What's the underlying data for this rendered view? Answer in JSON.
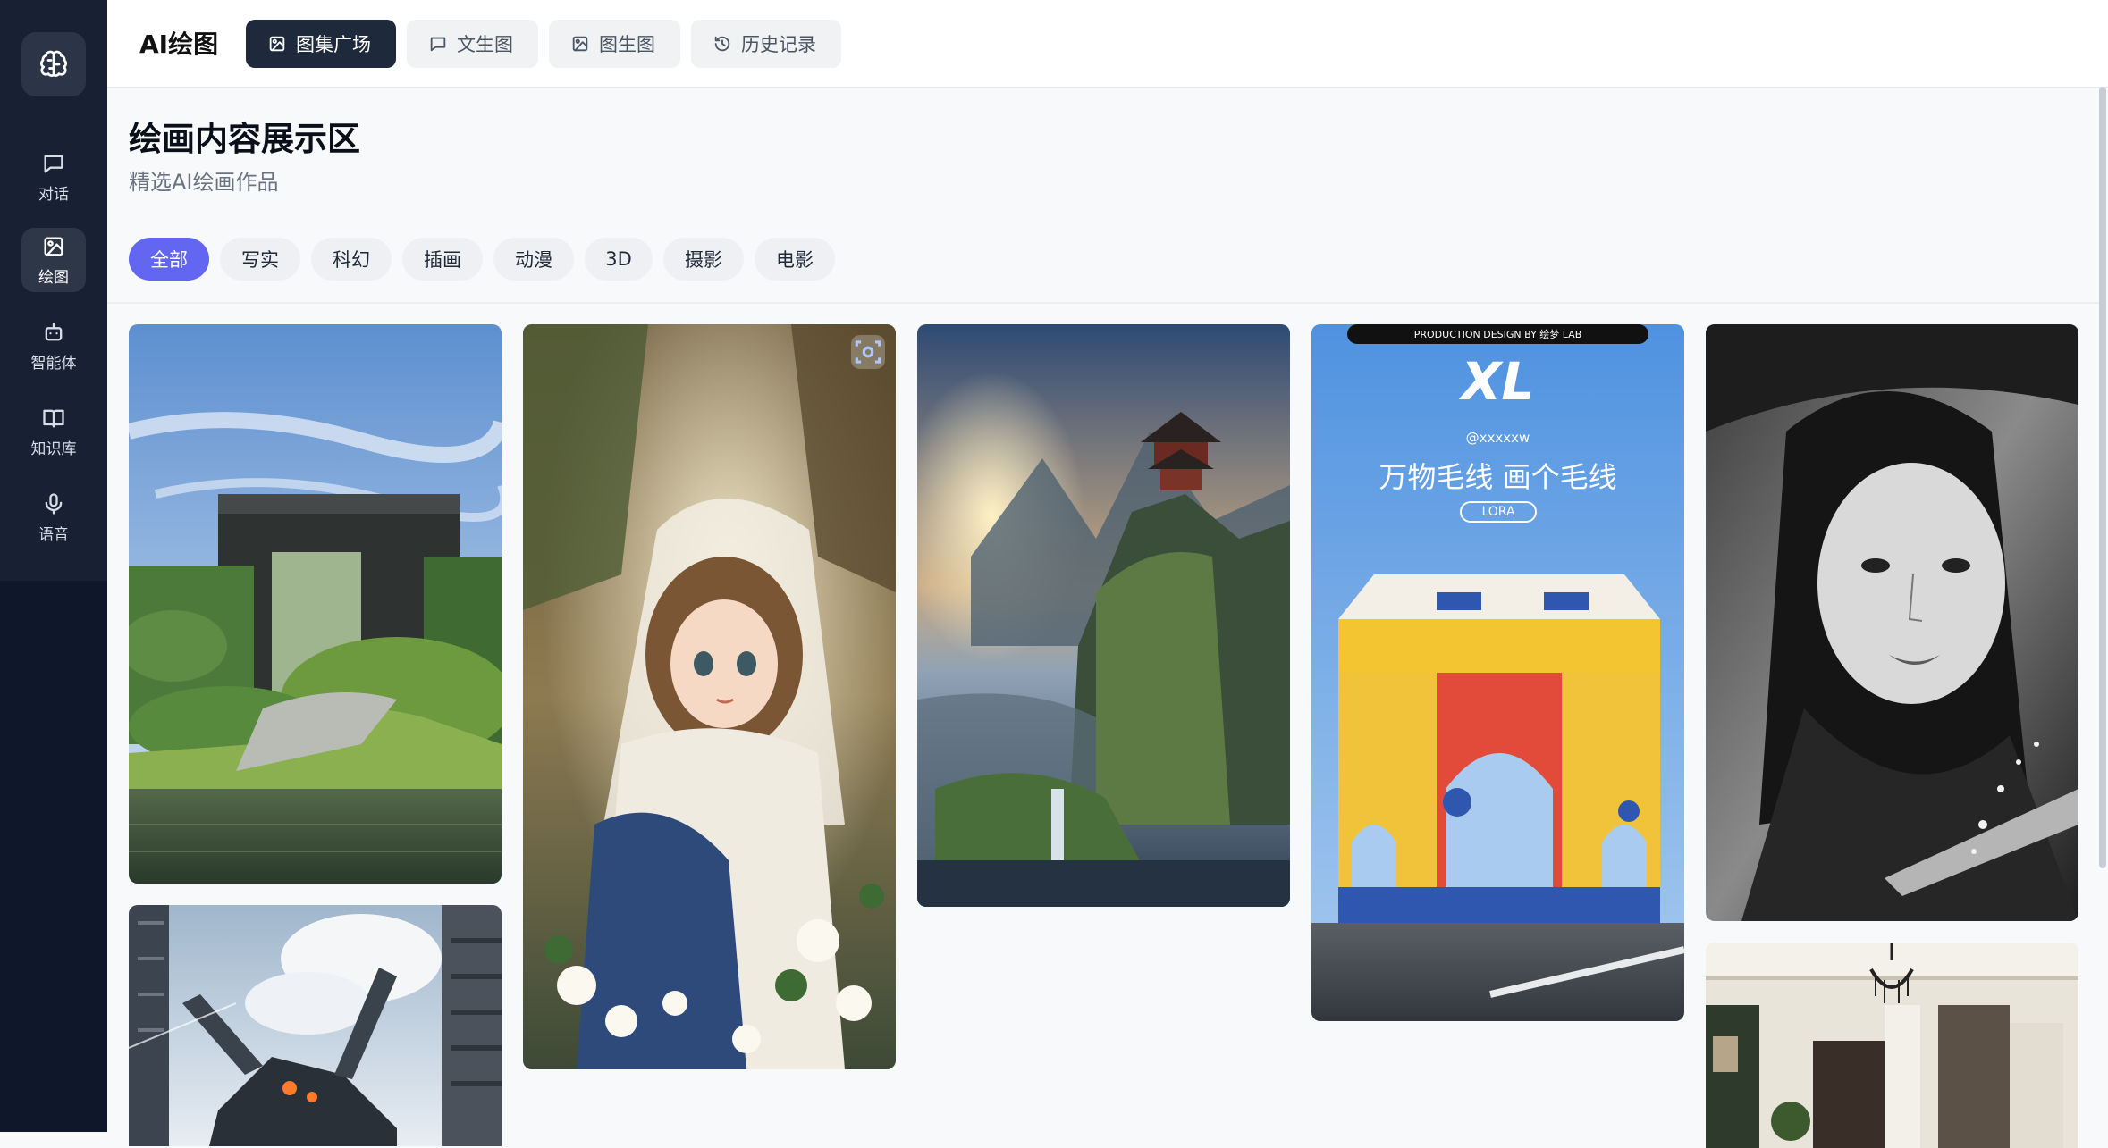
{
  "app": {
    "title": "AI绘图"
  },
  "header": {
    "tabs": [
      {
        "label": "图集广场",
        "icon": "image-icon",
        "active": true
      },
      {
        "label": "文生图",
        "icon": "chat-bubble-icon",
        "active": false
      },
      {
        "label": "图生图",
        "icon": "image-icon",
        "active": false
      },
      {
        "label": "历史记录",
        "icon": "history-icon",
        "active": false
      }
    ]
  },
  "sidebar": {
    "logo_icon": "brain-icon",
    "items": [
      {
        "label": "对话",
        "icon": "chat-bubble-icon",
        "active": false
      },
      {
        "label": "绘图",
        "icon": "image-icon",
        "active": true
      },
      {
        "label": "智能体",
        "icon": "bot-icon",
        "active": false
      },
      {
        "label": "知识库",
        "icon": "book-icon",
        "active": false
      },
      {
        "label": "语音",
        "icon": "microphone-icon",
        "active": false
      }
    ]
  },
  "main": {
    "title": "绘画内容展示区",
    "subtitle": "精选AI绘画作品",
    "filters": [
      "全部",
      "写实",
      "科幻",
      "插画",
      "动漫",
      "3D",
      "摄影",
      "电影"
    ],
    "active_filter": "全部"
  },
  "gallery": {
    "poster": {
      "banner": "PRODUCTION DESIGN BY 绘梦 LAB",
      "title": "XL",
      "handle": "@xxxxxw",
      "slogan": "万物毛线 画个毛线",
      "tag": "LORA"
    }
  },
  "colors": {
    "accent": "#6366f1",
    "sidebar": "#0f172a",
    "active_tab": "#1e293b"
  }
}
